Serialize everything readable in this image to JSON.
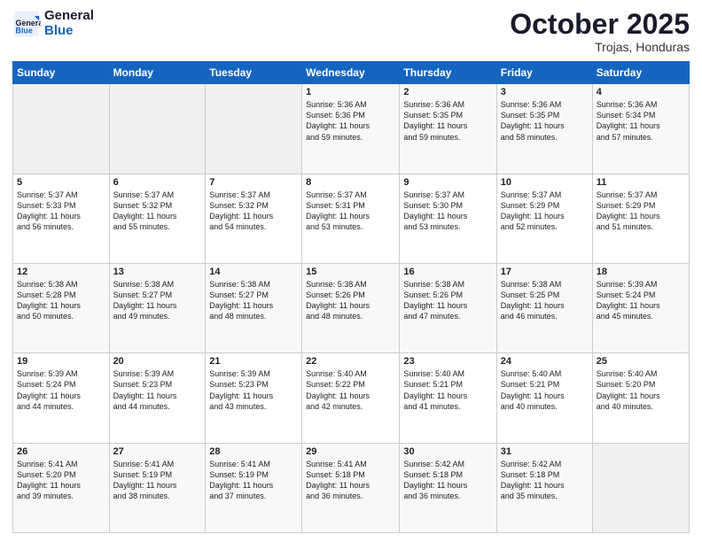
{
  "header": {
    "logo_line1": "General",
    "logo_line2": "Blue",
    "month": "October 2025",
    "location": "Trojas, Honduras"
  },
  "days_of_week": [
    "Sunday",
    "Monday",
    "Tuesday",
    "Wednesday",
    "Thursday",
    "Friday",
    "Saturday"
  ],
  "weeks": [
    [
      {
        "num": "",
        "info": ""
      },
      {
        "num": "",
        "info": ""
      },
      {
        "num": "",
        "info": ""
      },
      {
        "num": "1",
        "info": "Sunrise: 5:36 AM\nSunset: 5:36 PM\nDaylight: 11 hours\nand 59 minutes."
      },
      {
        "num": "2",
        "info": "Sunrise: 5:36 AM\nSunset: 5:35 PM\nDaylight: 11 hours\nand 59 minutes."
      },
      {
        "num": "3",
        "info": "Sunrise: 5:36 AM\nSunset: 5:35 PM\nDaylight: 11 hours\nand 58 minutes."
      },
      {
        "num": "4",
        "info": "Sunrise: 5:36 AM\nSunset: 5:34 PM\nDaylight: 11 hours\nand 57 minutes."
      }
    ],
    [
      {
        "num": "5",
        "info": "Sunrise: 5:37 AM\nSunset: 5:33 PM\nDaylight: 11 hours\nand 56 minutes."
      },
      {
        "num": "6",
        "info": "Sunrise: 5:37 AM\nSunset: 5:32 PM\nDaylight: 11 hours\nand 55 minutes."
      },
      {
        "num": "7",
        "info": "Sunrise: 5:37 AM\nSunset: 5:32 PM\nDaylight: 11 hours\nand 54 minutes."
      },
      {
        "num": "8",
        "info": "Sunrise: 5:37 AM\nSunset: 5:31 PM\nDaylight: 11 hours\nand 53 minutes."
      },
      {
        "num": "9",
        "info": "Sunrise: 5:37 AM\nSunset: 5:30 PM\nDaylight: 11 hours\nand 53 minutes."
      },
      {
        "num": "10",
        "info": "Sunrise: 5:37 AM\nSunset: 5:29 PM\nDaylight: 11 hours\nand 52 minutes."
      },
      {
        "num": "11",
        "info": "Sunrise: 5:37 AM\nSunset: 5:29 PM\nDaylight: 11 hours\nand 51 minutes."
      }
    ],
    [
      {
        "num": "12",
        "info": "Sunrise: 5:38 AM\nSunset: 5:28 PM\nDaylight: 11 hours\nand 50 minutes."
      },
      {
        "num": "13",
        "info": "Sunrise: 5:38 AM\nSunset: 5:27 PM\nDaylight: 11 hours\nand 49 minutes."
      },
      {
        "num": "14",
        "info": "Sunrise: 5:38 AM\nSunset: 5:27 PM\nDaylight: 11 hours\nand 48 minutes."
      },
      {
        "num": "15",
        "info": "Sunrise: 5:38 AM\nSunset: 5:26 PM\nDaylight: 11 hours\nand 48 minutes."
      },
      {
        "num": "16",
        "info": "Sunrise: 5:38 AM\nSunset: 5:26 PM\nDaylight: 11 hours\nand 47 minutes."
      },
      {
        "num": "17",
        "info": "Sunrise: 5:38 AM\nSunset: 5:25 PM\nDaylight: 11 hours\nand 46 minutes."
      },
      {
        "num": "18",
        "info": "Sunrise: 5:39 AM\nSunset: 5:24 PM\nDaylight: 11 hours\nand 45 minutes."
      }
    ],
    [
      {
        "num": "19",
        "info": "Sunrise: 5:39 AM\nSunset: 5:24 PM\nDaylight: 11 hours\nand 44 minutes."
      },
      {
        "num": "20",
        "info": "Sunrise: 5:39 AM\nSunset: 5:23 PM\nDaylight: 11 hours\nand 44 minutes."
      },
      {
        "num": "21",
        "info": "Sunrise: 5:39 AM\nSunset: 5:23 PM\nDaylight: 11 hours\nand 43 minutes."
      },
      {
        "num": "22",
        "info": "Sunrise: 5:40 AM\nSunset: 5:22 PM\nDaylight: 11 hours\nand 42 minutes."
      },
      {
        "num": "23",
        "info": "Sunrise: 5:40 AM\nSunset: 5:21 PM\nDaylight: 11 hours\nand 41 minutes."
      },
      {
        "num": "24",
        "info": "Sunrise: 5:40 AM\nSunset: 5:21 PM\nDaylight: 11 hours\nand 40 minutes."
      },
      {
        "num": "25",
        "info": "Sunrise: 5:40 AM\nSunset: 5:20 PM\nDaylight: 11 hours\nand 40 minutes."
      }
    ],
    [
      {
        "num": "26",
        "info": "Sunrise: 5:41 AM\nSunset: 5:20 PM\nDaylight: 11 hours\nand 39 minutes."
      },
      {
        "num": "27",
        "info": "Sunrise: 5:41 AM\nSunset: 5:19 PM\nDaylight: 11 hours\nand 38 minutes."
      },
      {
        "num": "28",
        "info": "Sunrise: 5:41 AM\nSunset: 5:19 PM\nDaylight: 11 hours\nand 37 minutes."
      },
      {
        "num": "29",
        "info": "Sunrise: 5:41 AM\nSunset: 5:18 PM\nDaylight: 11 hours\nand 36 minutes."
      },
      {
        "num": "30",
        "info": "Sunrise: 5:42 AM\nSunset: 5:18 PM\nDaylight: 11 hours\nand 36 minutes."
      },
      {
        "num": "31",
        "info": "Sunrise: 5:42 AM\nSunset: 5:18 PM\nDaylight: 11 hours\nand 35 minutes."
      },
      {
        "num": "",
        "info": ""
      }
    ]
  ]
}
